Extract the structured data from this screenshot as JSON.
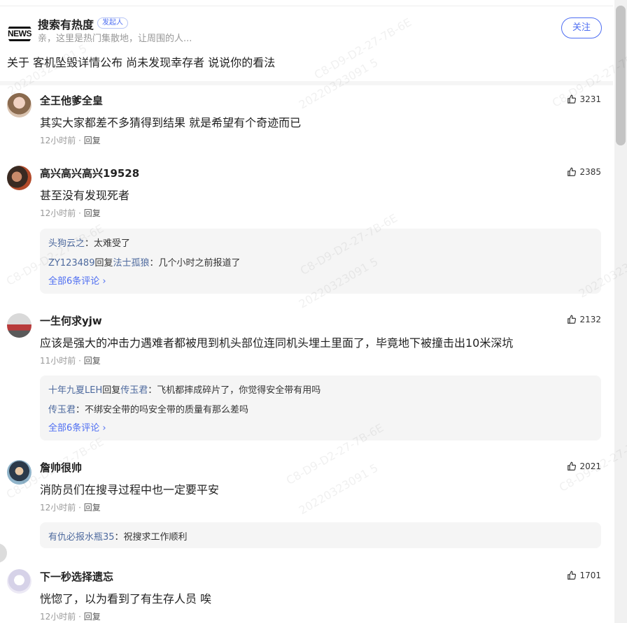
{
  "header": {
    "author": "搜索有热度",
    "badge": "发起人",
    "intro": "亲，这里是热门集散地，让周围的人...",
    "follow_label": "关注",
    "topic": "关于 客机坠毁详情公布 尚未发现幸存者 说说你的看法"
  },
  "comments": [
    {
      "name": "全王他爹全皇",
      "likes": "3231",
      "text": "其实大家都差不多猜得到结果 就是希望有个奇迹而已",
      "time": "12小时前",
      "reply_label": "回复"
    },
    {
      "name": "高兴高兴高兴19528",
      "likes": "2385",
      "text": "甚至没有发现死者",
      "time": "12小时前",
      "reply_label": "回复",
      "replies": [
        {
          "name": "头狗云之",
          "reply_verb": "",
          "target": "",
          "text": "：太难受了"
        },
        {
          "name": "ZY123489",
          "reply_verb": "回复",
          "target": "法士孤狼",
          "text": "：几个小时之前报道了"
        }
      ],
      "more": "全部6条评论 ›"
    },
    {
      "name": "一生何求yjw",
      "likes": "2132",
      "text": "应该是强大的冲击力遇难者都被甩到机头部位连同机头埋土里面了，毕竟地下被撞击出10米深坑",
      "time": "11小时前",
      "reply_label": "回复",
      "replies": [
        {
          "name": "十年九夏LEH",
          "reply_verb": "回复",
          "target": "传玉君",
          "text": "：飞机都摔成碎片了，你觉得安全带有用吗"
        },
        {
          "name": "传玉君",
          "reply_verb": "",
          "target": "",
          "text": "：不绑安全带的吗安全带的质量有那么差吗"
        }
      ],
      "more": "全部6条评论 ›"
    },
    {
      "name": "詹帅很帅",
      "likes": "2021",
      "text": "消防员们在搜寻过程中也一定要平安",
      "time": "12小时前",
      "reply_label": "回复",
      "replies": [
        {
          "name": "有仇必报水瓶35",
          "reply_verb": "",
          "target": "",
          "text": "：祝搜求工作顺利"
        }
      ]
    },
    {
      "name": "下一秒选择遗忘",
      "likes": "1701",
      "text": "恍惚了，以为看到了有生存人员 唉",
      "time": "12小时前",
      "reply_label": "回复"
    }
  ],
  "watermark": {
    "line1": "C8-D9-D2-27-7B-6E",
    "line2": "20220323091 5"
  },
  "colors": {
    "link": "#4e6ef2",
    "username_link": "#4e6a9e",
    "reply_bg": "#f5f5f5"
  }
}
